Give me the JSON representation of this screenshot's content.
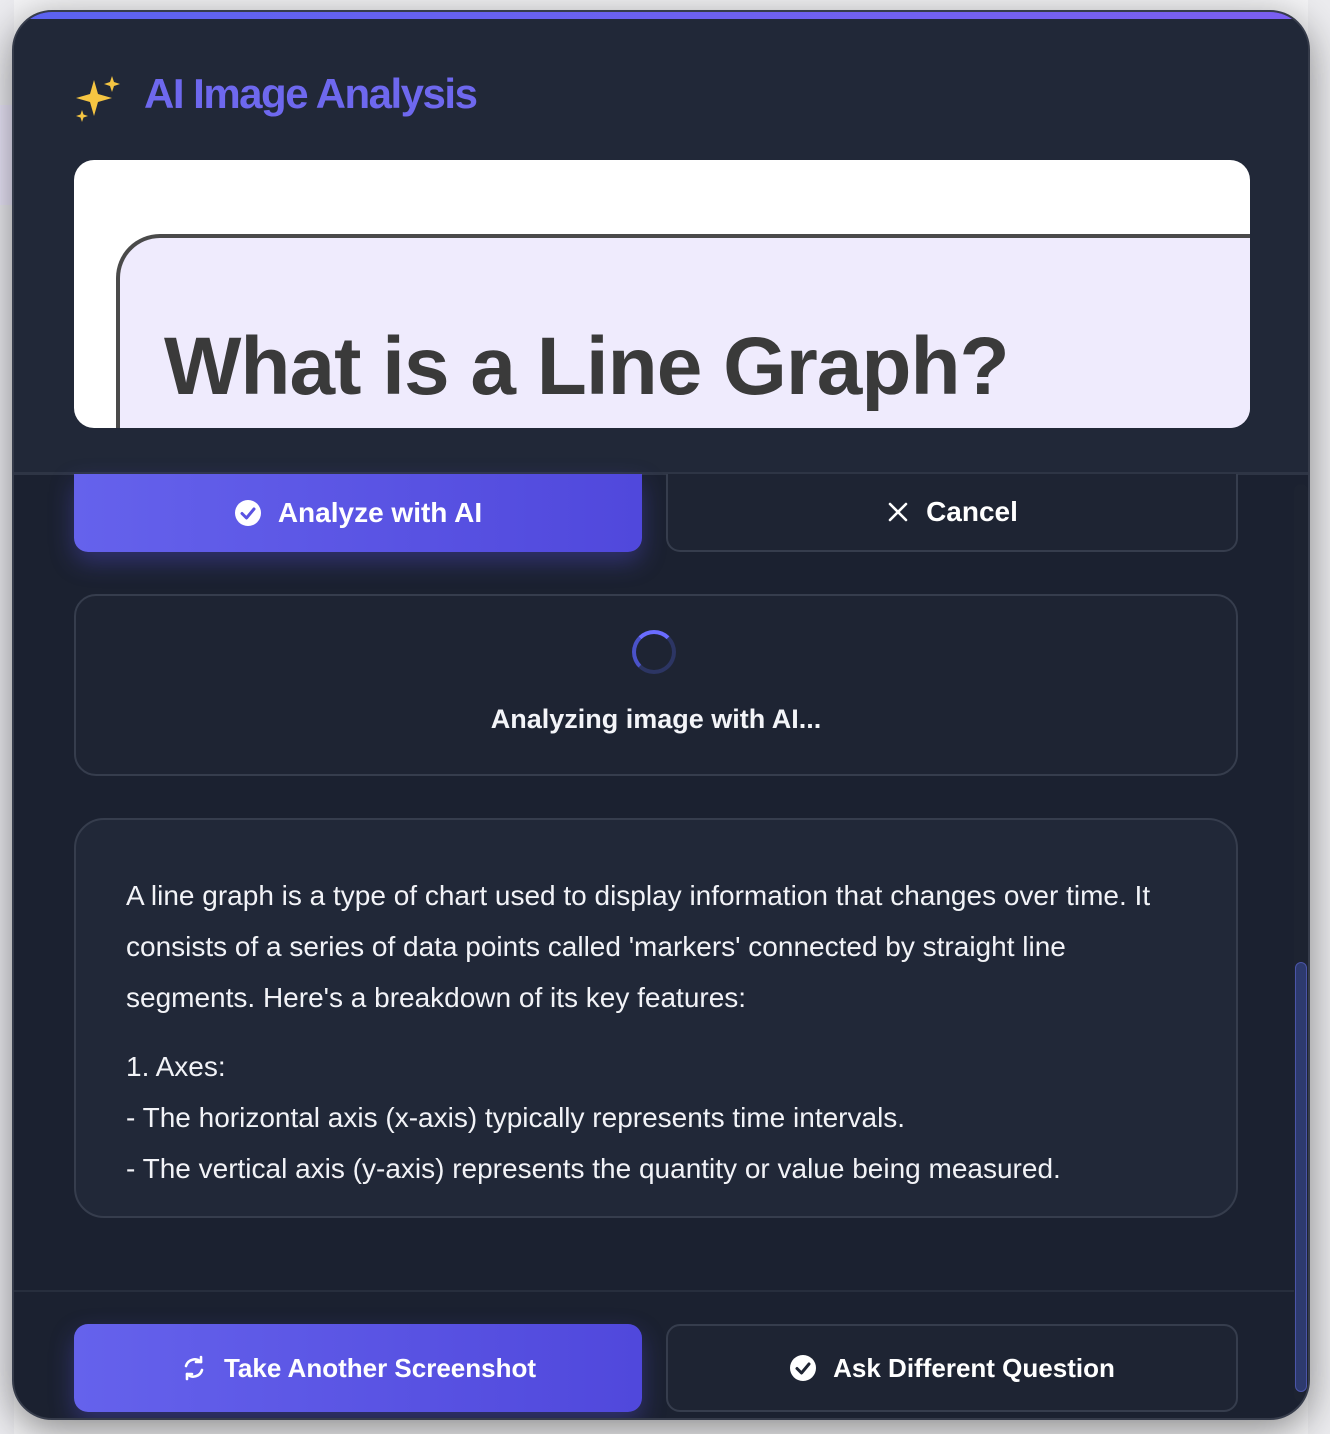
{
  "dialog": {
    "title": "AI Image Analysis",
    "title_icon": "sparkles-icon"
  },
  "preview": {
    "heading": "What is a Line Graph?"
  },
  "actions": {
    "analyze_label": "Analyze with AI",
    "cancel_label": "Cancel"
  },
  "status": {
    "text": "Analyzing image with AI..."
  },
  "result": {
    "intro": "A line graph is a type of chart used to display information that changes over time. It consists of a series of data points called 'markers' connected by straight line segments. Here's a breakdown of its key features:",
    "section_title": "1. Axes:",
    "bullet_1": "- The horizontal axis (x-axis) typically represents time intervals.",
    "bullet_2": "- The vertical axis (y-axis) represents the quantity or value being measured."
  },
  "footer": {
    "screenshot_label": "Take Another Screenshot",
    "ask_label": "Ask Different Question"
  },
  "colors": {
    "accent": "#5b56e6",
    "title": "#6e68ee",
    "dialog_bg": "#1b2130"
  }
}
